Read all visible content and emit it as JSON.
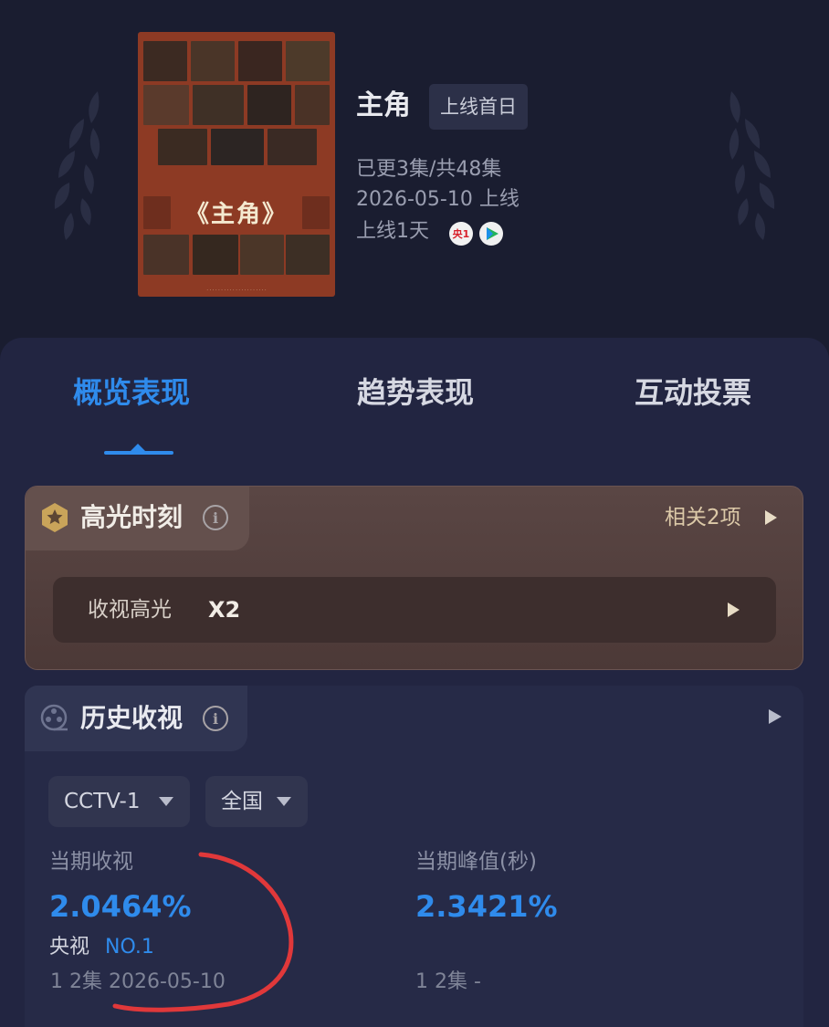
{
  "show": {
    "title": "主角",
    "badge": "上线首日",
    "episodes": "已更3集/共48集",
    "release": "2026-05-10 上线",
    "days_online": "上线1天",
    "channel_logo_text": "央1",
    "poster_title": "《主角》"
  },
  "tabs": [
    {
      "label": "概览表现",
      "active": true
    },
    {
      "label": "趋势表现",
      "active": false
    },
    {
      "label": "互动投票",
      "active": false
    }
  ],
  "highlight": {
    "title": "高光时刻",
    "info_glyph": "i",
    "related": "相关2项",
    "row_label": "收视高光",
    "row_value": "X2"
  },
  "history": {
    "title": "历史收视",
    "info_glyph": "i",
    "channel_filter": "CCTV-1",
    "region_filter": "全国",
    "current_rating_label": "当期收视",
    "current_rating_value": "2.0464%",
    "rank_label": "央视",
    "rank_value": "NO.1",
    "current_episode_line": "1 2集 2026-05-10",
    "peak_label": "当期峰值(秒)",
    "peak_value": "2.3421%",
    "peak_episode_line": "1 2集 -"
  },
  "colors": {
    "accent": "#2f8bec",
    "background": "#1a1d30",
    "panel": "#222541",
    "highlight_card": "#5a4644",
    "annotation_stroke": "#e0383a"
  },
  "icons": {
    "highlight": "star-hexagon-icon",
    "history": "film-reel-icon",
    "info": "info-icon",
    "arrow": "play-arrow-icon",
    "dropdown": "caret-down-icon"
  }
}
